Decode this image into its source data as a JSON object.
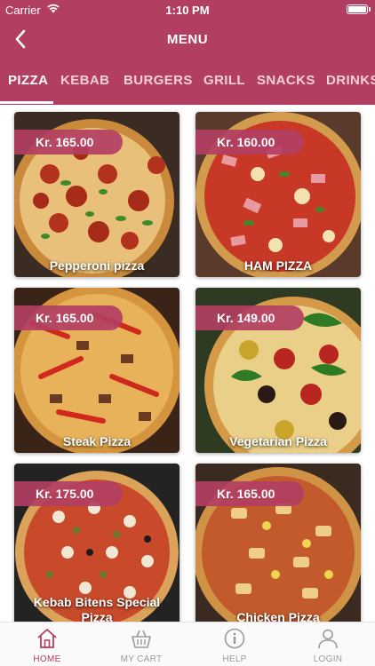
{
  "status_bar": {
    "carrier": "Carrier",
    "time": "1:10 PM",
    "icons": [
      "wifi-icon",
      "battery-icon"
    ]
  },
  "nav": {
    "title": "MENU",
    "back_icon": "chevron-left-icon"
  },
  "category_tabs": [
    {
      "label": "PIZZA",
      "active": true
    },
    {
      "label": "KEBAB",
      "active": false
    },
    {
      "label": "BURGERS",
      "active": false
    },
    {
      "label": "GRILL",
      "active": false
    },
    {
      "label": "SNACKS",
      "active": false
    },
    {
      "label": "DRINKS",
      "active": false
    }
  ],
  "products": [
    {
      "price": "Kr. 165.00",
      "name": "Pepperoni pizza"
    },
    {
      "price": "Kr. 160.00",
      "name": "HAM PIZZA"
    },
    {
      "price": "Kr. 165.00",
      "name": "Steak Pizza"
    },
    {
      "price": "Kr. 149.00",
      "name": "Vegetarian Pizza"
    },
    {
      "price": "Kr. 175.00",
      "name": "Kebab Bitens Special Pizza"
    },
    {
      "price": "Kr. 165.00",
      "name": "Chicken Pizza"
    }
  ],
  "tabbar": [
    {
      "label": "HOME",
      "icon": "home-icon",
      "active": true
    },
    {
      "label": "MY CART",
      "icon": "basket-icon",
      "active": false
    },
    {
      "label": "HELP",
      "icon": "info-icon",
      "active": false
    },
    {
      "label": "LOGIN",
      "icon": "user-icon",
      "active": false
    }
  ],
  "colors": {
    "brand": "#b23f62",
    "tab_inactive": "#f3cfd9",
    "tabbar_inactive": "#9a9a9a"
  }
}
